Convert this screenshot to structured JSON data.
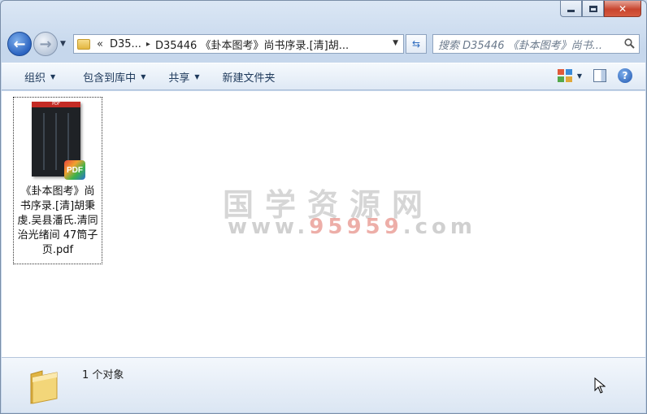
{
  "window": {
    "close_glyph": "✕",
    "restore_glyph": "□"
  },
  "nav": {
    "back_glyph": "←",
    "forward_glyph": "→",
    "dropdown_glyph": "▼"
  },
  "address": {
    "overflow_glyph": "«",
    "crumb_1": "D35...",
    "crumb_sep": "▸",
    "crumb_2": "D35446 《卦本图考》尚书序录.[清]胡...",
    "dropdown_glyph": "▼",
    "refresh_glyph": "⇆"
  },
  "search": {
    "placeholder": "搜索 D35446 《卦本图考》尚书..."
  },
  "toolbar": {
    "organize": "组织",
    "include_in_library": "包含到库中",
    "share": "共享",
    "new_folder": "新建文件夹",
    "caret": "▼",
    "help": "?"
  },
  "files": [
    {
      "name": "《卦本图考》尚书序录.[清]胡秉虔.吴县潘氏.清同治光绪间 47筒子页.pdf",
      "badge": "PDF",
      "thumb_header": "PDF"
    }
  ],
  "watermark": {
    "title": "国学资源网",
    "url_prefix": "www.",
    "url_number": "95959",
    "url_suffix": ".com"
  },
  "details": {
    "status": "1 个对象"
  },
  "colors": {
    "accent": "#2b63c0",
    "toolbar_text": "#1e395b",
    "close_red": "#c8452e"
  }
}
